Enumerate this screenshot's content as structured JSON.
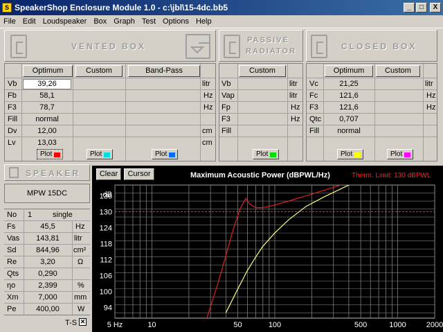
{
  "window": {
    "title": "SpeakerShop Enclosure Module 1.0 - c:\\jbl\\15-4dc.bb5",
    "minimize": "_",
    "maximize": "□",
    "close": "X",
    "app_icon": "S"
  },
  "menu": [
    "File",
    "Edit",
    "Loudspeaker",
    "Box",
    "Graph",
    "Test",
    "Options",
    "Help"
  ],
  "headers": {
    "vented": "VENTED BOX",
    "passive_line1": "PASSIVE",
    "passive_line2": "RADIATOR",
    "closed": "CLOSED BOX",
    "speaker": "SPEAKER"
  },
  "vented": {
    "buttons": {
      "optimum": "Optimum",
      "custom": "Custom",
      "bandpass": "Band-Pass"
    },
    "rows": [
      {
        "label": "Vb",
        "value": "39,26",
        "unit": "litr"
      },
      {
        "label": "Fb",
        "value": "58,1",
        "unit": "Hz"
      },
      {
        "label": "F3",
        "value": "78,7",
        "unit": "Hz"
      },
      {
        "label": "Fill",
        "value": "normal",
        "unit": ""
      },
      {
        "label": "Dv",
        "value": "12,00",
        "unit": "cm"
      },
      {
        "label": "Lv",
        "value": "13,03",
        "unit": "cm"
      }
    ],
    "plot_label": "Plot"
  },
  "passive": {
    "buttons": {
      "custom": "Custom"
    },
    "rows": [
      {
        "label": "Vb",
        "unit": "litr"
      },
      {
        "label": "Vap",
        "unit": "litr"
      },
      {
        "label": "Fp",
        "unit": "Hz"
      },
      {
        "label": "F3",
        "unit": "Hz"
      },
      {
        "label": "Fill",
        "unit": ""
      }
    ],
    "plot_label": "Plot"
  },
  "closed": {
    "buttons": {
      "optimum": "Optimum",
      "custom": "Custom"
    },
    "rows": [
      {
        "label": "Vc",
        "value": "21,25",
        "unit": "litr"
      },
      {
        "label": "Fc",
        "value": "121,6",
        "unit": "Hz"
      },
      {
        "label": "F3",
        "value": "121,6",
        "unit": "Hz"
      },
      {
        "label": "Qtc",
        "value": "0,707",
        "unit": ""
      },
      {
        "label": "Fill",
        "value": "normal",
        "unit": ""
      }
    ],
    "plot_label": "Plot"
  },
  "plot_colors": {
    "vented1": "#ff0000",
    "vented2": "#00e0e0",
    "vented3": "#0070ff",
    "passive": "#00e000",
    "closed1": "#ffff00",
    "closed2": "#ff00ff"
  },
  "speaker": {
    "model": "MPW 15DC",
    "no_label": "No",
    "no_value": "1",
    "config": "single",
    "params": [
      {
        "label": "Fs",
        "value": "45,5",
        "unit": "Hz"
      },
      {
        "label": "Vas",
        "value": "143,81",
        "unit": "litr"
      },
      {
        "label": "Sd",
        "value": "844,96",
        "unit": "cm²"
      },
      {
        "label": "Re",
        "value": "3,20",
        "unit": "Ω"
      },
      {
        "label": "Qts",
        "value": "0,290",
        "unit": ""
      },
      {
        "label": "ηo",
        "value": "2,399",
        "unit": "%"
      },
      {
        "label": "Xm",
        "value": "7,000",
        "unit": "mm"
      },
      {
        "label": "Pe",
        "value": "400,00",
        "unit": "W"
      }
    ],
    "ts_label": "T-S",
    "ts_checked": true
  },
  "graph": {
    "buttons": {
      "clear": "Clear",
      "cursor": "Cursor"
    },
    "title": "Maximum Acoustic Power (dBPWL/Hz)",
    "therm_limit": "Therm. Limit: 130 dBPWL",
    "ylabel": "dB",
    "yticks": [
      "136",
      "130",
      "124",
      "118",
      "112",
      "106",
      "100",
      "94"
    ],
    "xticks": [
      "5 Hz",
      "10",
      "50",
      "100",
      "500",
      "1000",
      "2000"
    ]
  },
  "chart_data": {
    "type": "line",
    "title": "Maximum Acoustic Power (dBPWL/Hz)",
    "xlabel": "",
    "ylabel": "dB",
    "xscale": "log",
    "xlim": [
      5,
      2000
    ],
    "ylim": [
      90,
      140
    ],
    "hline": {
      "y": 130,
      "label": "Therm. Limit: 130 dBPWL",
      "color": "#ff3030"
    },
    "series": [
      {
        "color": "#e02020",
        "x": [
          28,
          35,
          45,
          52,
          58,
          62,
          70,
          80,
          100,
          130,
          180,
          250,
          400,
          700
        ],
        "y": [
          90,
          104,
          122,
          131,
          135,
          133,
          131.5,
          131.5,
          132.5,
          134,
          136,
          138,
          141,
          146
        ]
      },
      {
        "color": "#ffff80",
        "x": [
          40,
          50,
          60,
          70,
          80,
          100,
          130,
          180,
          250,
          400,
          700
        ],
        "y": [
          92,
          101,
          108,
          113,
          117,
          122,
          127,
          132,
          135.5,
          140,
          145
        ]
      }
    ]
  }
}
